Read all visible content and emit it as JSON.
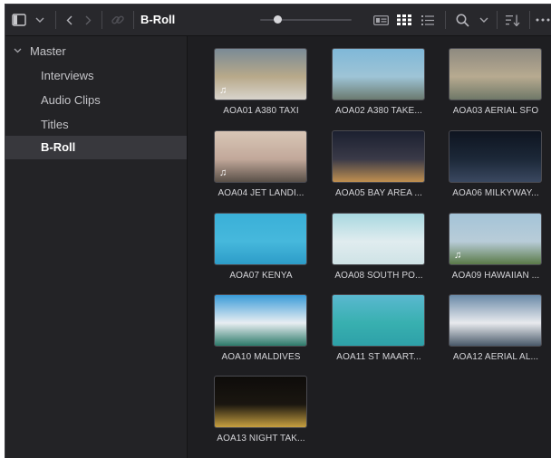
{
  "toolbar": {
    "sidebar_toggle_icon": "sidebar-panel-icon",
    "dropdown_icon": "chevron-down-icon",
    "back_icon": "chevron-left-icon",
    "forward_icon": "chevron-right-icon",
    "link_icon": "link-icon",
    "breadcrumb": "B-Roll",
    "zoom_slider_value": 0.2,
    "view_metadata_icon": "metadata-view-icon",
    "view_thumbnail_icon": "thumbnail-view-icon",
    "view_list_icon": "list-view-icon",
    "search_icon": "search-icon",
    "sort_icon": "sort-icon",
    "more_icon": "more-icon"
  },
  "sidebar": {
    "root": {
      "label": "Master",
      "icon": "chevron-down-icon"
    },
    "items": [
      {
        "label": "Interviews",
        "selected": false
      },
      {
        "label": "Audio Clips",
        "selected": false
      },
      {
        "label": "Titles",
        "selected": false
      },
      {
        "label": "B-Roll",
        "selected": true
      }
    ]
  },
  "clips": [
    {
      "name": "AOA01 A380 TAXI",
      "has_audio": true,
      "colors": [
        "#7a8a96",
        "#b8a98a",
        "#d8d4cc"
      ]
    },
    {
      "name": "AOA02 A380 TAKE...",
      "has_audio": false,
      "colors": [
        "#7fb8d8",
        "#9ec4d6",
        "#6b7a70"
      ]
    },
    {
      "name": "AOA03 AERIAL SFO",
      "has_audio": false,
      "colors": [
        "#8e8a80",
        "#b7aa90",
        "#6f7868"
      ]
    },
    {
      "name": "AOA04 JET LANDI...",
      "has_audio": true,
      "colors": [
        "#d8c6b6",
        "#c2a89a",
        "#5a5048"
      ]
    },
    {
      "name": "AOA05 BAY AREA ...",
      "has_audio": false,
      "colors": [
        "#1b2030",
        "#3a3a48",
        "#c09050"
      ]
    },
    {
      "name": "AOA06 MILKYWAY...",
      "has_audio": false,
      "colors": [
        "#0e1420",
        "#1c2838",
        "#3a4860"
      ]
    },
    {
      "name": "AOA07 KENYA",
      "has_audio": false,
      "colors": [
        "#3ab0d8",
        "#46b8dc",
        "#2d9cc8"
      ]
    },
    {
      "name": "AOA08 SOUTH PO...",
      "has_audio": false,
      "colors": [
        "#a8d8e0",
        "#e0ecef",
        "#cfe3e6"
      ]
    },
    {
      "name": "AOA09 HAWAIIAN ...",
      "has_audio": true,
      "colors": [
        "#a4c4d8",
        "#b8ccd8",
        "#5a7a48"
      ]
    },
    {
      "name": "AOA10 MALDIVES",
      "has_audio": false,
      "colors": [
        "#3a9cd8",
        "#e8eef2",
        "#2d7a6a"
      ]
    },
    {
      "name": "AOA11 ST MAART...",
      "has_audio": false,
      "colors": [
        "#5ab8d0",
        "#38b0b0",
        "#2ea0a8"
      ]
    },
    {
      "name": "AOA12 AERIAL AL...",
      "has_audio": false,
      "colors": [
        "#6a8aa8",
        "#e8eaee",
        "#4a5a6a"
      ]
    },
    {
      "name": "AOA13 NIGHT TAK...",
      "has_audio": false,
      "colors": [
        "#0e0c0a",
        "#1a1610",
        "#c8a040"
      ]
    }
  ]
}
